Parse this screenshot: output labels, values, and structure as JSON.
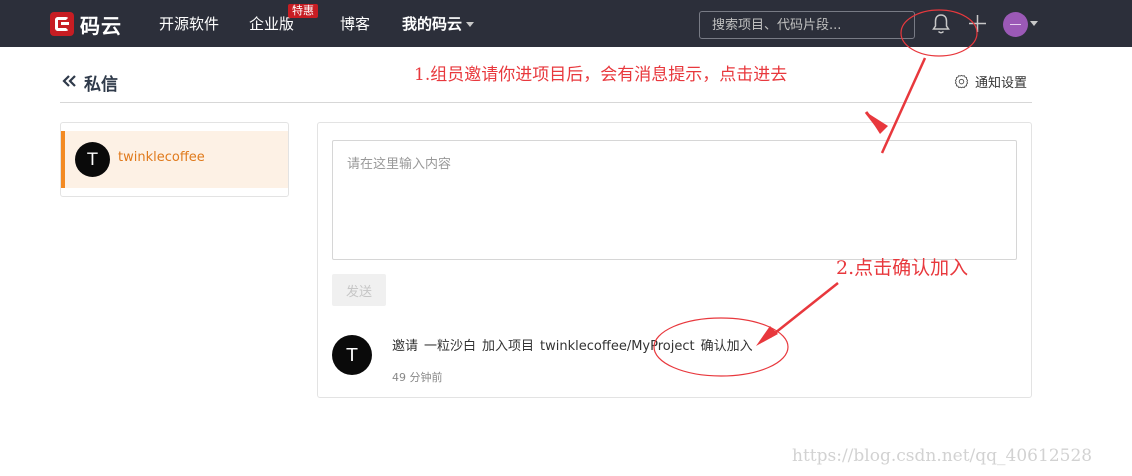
{
  "header": {
    "logo_text": "码云",
    "nav": [
      {
        "label": "开源软件"
      },
      {
        "label": "企业版"
      },
      {
        "label": "博客"
      },
      {
        "label": "我的码云"
      }
    ],
    "badge": "特惠",
    "search_placeholder": "搜索项目、代码片段..."
  },
  "page": {
    "title": "私信",
    "settings_label": "通知设置"
  },
  "sidebar": {
    "conversations": [
      {
        "avatar_letter": "T",
        "name": "twinklecoffee"
      }
    ]
  },
  "composer": {
    "placeholder": "请在这里输入内容",
    "send_label": "发送"
  },
  "message": {
    "avatar_letter": "T",
    "parts": [
      "邀请",
      "一粒沙白",
      "加入项目",
      "twinklecoffee/MyProject",
      "确认加入"
    ],
    "time": "49 分钟前"
  },
  "annotations": {
    "step1": "1.组员邀请你进项目后，会有消息提示，点击进去",
    "step2": "2.点击确认加入",
    "watermark": "https://blog.csdn.net/qq_40612528"
  },
  "colors": {
    "header_bg": "#2c2f3a",
    "brand_red": "#c71d23",
    "accent_orange": "#f38a23",
    "annotation_red": "#e8383d"
  }
}
